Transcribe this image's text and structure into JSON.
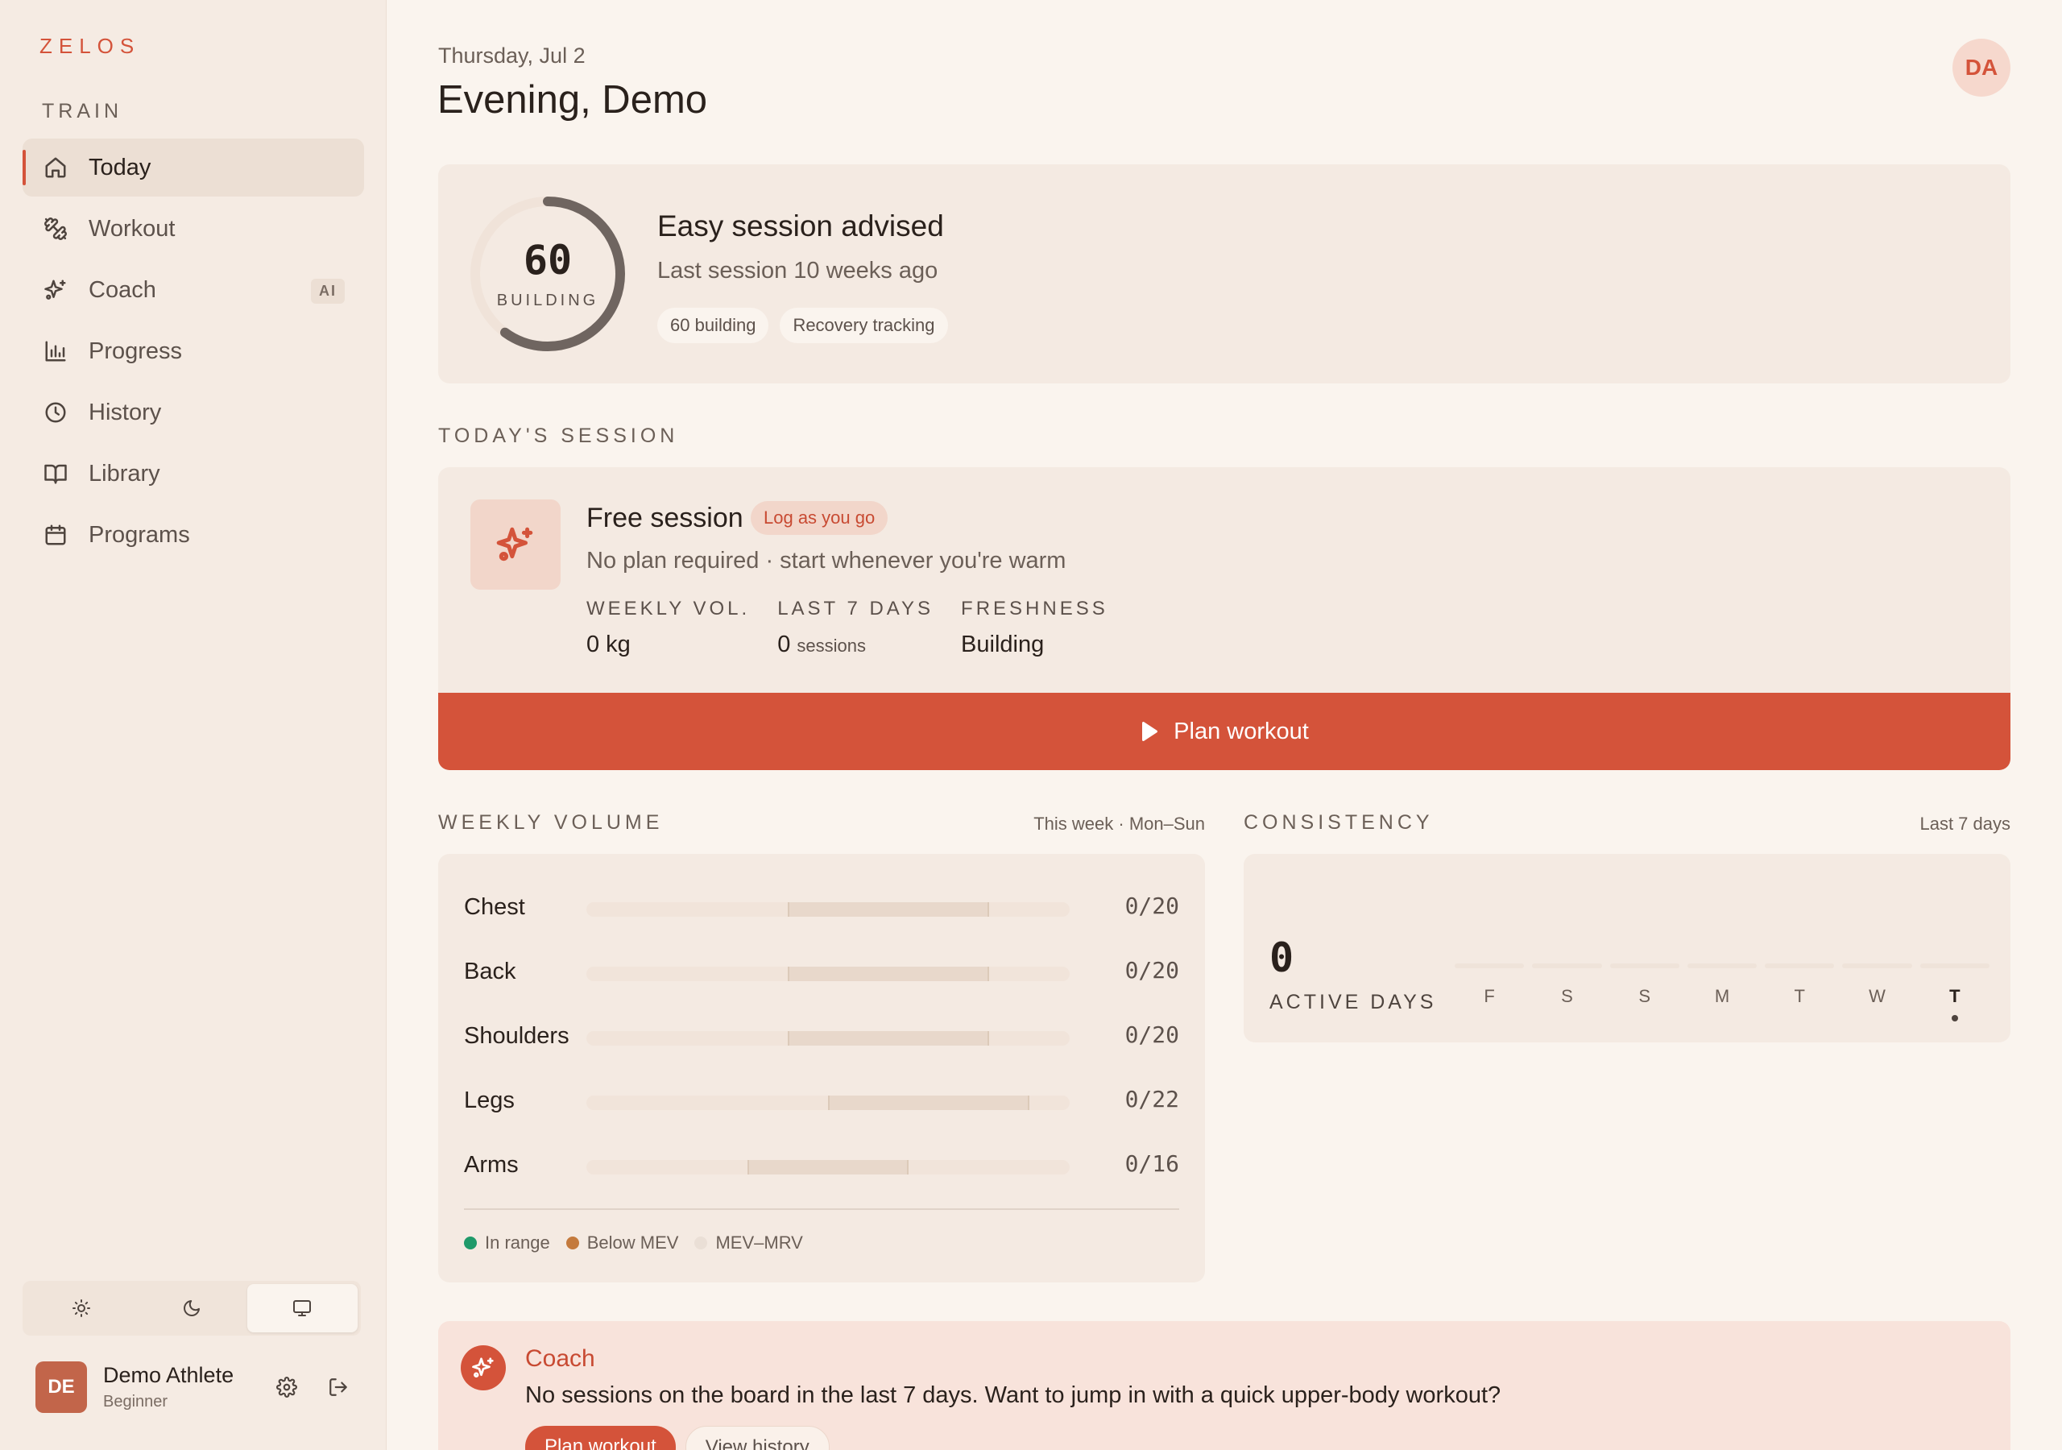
{
  "brand": "ZELOS",
  "sidebar": {
    "section": "TRAIN",
    "items": [
      {
        "label": "Today",
        "icon": "home-icon",
        "active": true
      },
      {
        "label": "Workout",
        "icon": "dumbbell-icon"
      },
      {
        "label": "Coach",
        "icon": "sparkle-icon",
        "badge": "AI"
      },
      {
        "label": "Progress",
        "icon": "bar-chart-icon"
      },
      {
        "label": "History",
        "icon": "clock-icon"
      },
      {
        "label": "Library",
        "icon": "book-icon"
      },
      {
        "label": "Programs",
        "icon": "calendar-icon"
      }
    ],
    "theme": {
      "options": [
        "light",
        "dark",
        "system"
      ],
      "selected": "system"
    },
    "user": {
      "initials": "DE",
      "name": "Demo Athlete",
      "level": "Beginner"
    }
  },
  "header": {
    "date": "Thursday, Jul 2",
    "greeting": "Evening, Demo",
    "avatar_initials": "DA"
  },
  "readiness": {
    "score": "60",
    "score_fraction": 0.6,
    "label": "BUILDING",
    "title": "Easy session advised",
    "subtitle": "Last session 10 weeks ago",
    "chips": [
      "60 building",
      "Recovery tracking"
    ]
  },
  "todays_session": {
    "heading": "TODAY'S SESSION",
    "title": "Free session",
    "badge": "Log as you go",
    "subtitle": "No plan required · start whenever you're warm",
    "stats": [
      {
        "label": "WEEKLY VOL.",
        "value": "0 kg",
        "unit": ""
      },
      {
        "label": "LAST 7 DAYS",
        "value": "0",
        "unit": "sessions"
      },
      {
        "label": "FRESHNESS",
        "value": "Building",
        "unit": ""
      }
    ],
    "cta": "Plan workout"
  },
  "weekly_volume": {
    "heading": "WEEKLY VOLUME",
    "range_label": "This week · Mon–Sun",
    "axis_max": 24,
    "rows": [
      {
        "name": "Chest",
        "sets": 0,
        "target": 20,
        "display": "0/20",
        "mev": 10,
        "mrv": 20
      },
      {
        "name": "Back",
        "sets": 0,
        "target": 20,
        "display": "0/20",
        "mev": 10,
        "mrv": 20
      },
      {
        "name": "Shoulders",
        "sets": 0,
        "target": 20,
        "display": "0/20",
        "mev": 10,
        "mrv": 20
      },
      {
        "name": "Legs",
        "sets": 0,
        "target": 22,
        "display": "0/22",
        "mev": 12,
        "mrv": 22
      },
      {
        "name": "Arms",
        "sets": 0,
        "target": 16,
        "display": "0/16",
        "mev": 8,
        "mrv": 16
      }
    ],
    "legend": [
      {
        "label": "In range",
        "color": "#1f9a6a"
      },
      {
        "label": "Below MEV",
        "color": "#c47a3d"
      },
      {
        "label": "MEV–MRV",
        "color": "#eadfd6"
      }
    ]
  },
  "consistency": {
    "heading": "CONSISTENCY",
    "range_label": "Last 7 days",
    "active_days": "0",
    "active_label": "ACTIVE DAYS",
    "days": [
      "F",
      "S",
      "S",
      "M",
      "T",
      "W",
      "T"
    ],
    "today_index": 6
  },
  "coach_card": {
    "title": "Coach",
    "message": "No sessions on the board in the last 7 days. Want to jump in with a quick upper-body workout?",
    "primary": "Plan workout",
    "secondary": "View history"
  },
  "colors": {
    "accent": "#d4533a",
    "background": "#faf4ee",
    "card": "#f4eae2",
    "sidebar": "#f5ebe3"
  }
}
